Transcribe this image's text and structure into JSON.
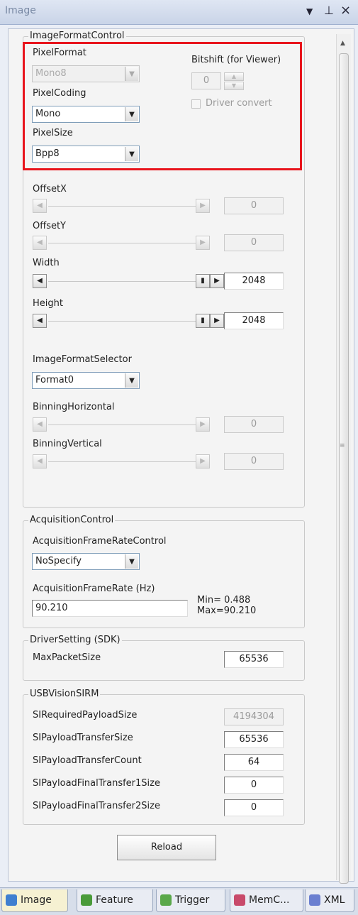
{
  "window": {
    "title": "Image",
    "dropdown_glyph": "▼",
    "pin_glyph": "⊥",
    "close_glyph": "×"
  },
  "image_format_control": {
    "legend": "ImageFormatControl",
    "pixel_format_label": "PixelFormat",
    "pixel_format_value": "Mono8",
    "bitshift_label": "Bitshift (for Viewer)",
    "bitshift_value": "0",
    "driver_convert_label": "Driver convert",
    "pixel_coding_label": "PixelCoding",
    "pixel_coding_value": "Mono",
    "pixel_size_label": "PixelSize",
    "pixel_size_value": "Bpp8",
    "offset_x_label": "OffsetX",
    "offset_x_value": "0",
    "offset_y_label": "OffsetY",
    "offset_y_value": "0",
    "width_label": "Width",
    "width_value": "2048",
    "height_label": "Height",
    "height_value": "2048",
    "selector_label": "ImageFormatSelector",
    "selector_value": "Format0",
    "binning_h_label": "BinningHorizontal",
    "binning_h_value": "0",
    "binning_v_label": "BinningVertical",
    "binning_v_value": "0"
  },
  "acquisition_control": {
    "legend": "AcquisitionControl",
    "rate_control_label": "AcquisitionFrameRateControl",
    "rate_control_value": "NoSpecify",
    "frame_rate_label": "AcquisitionFrameRate (Hz)",
    "frame_rate_value": "90.210",
    "min_text": "Min= 0.488",
    "max_text": "Max=90.210"
  },
  "driver_setting": {
    "legend": "DriverSetting (SDK)",
    "max_packet_label": "MaxPacketSize",
    "max_packet_value": "65536"
  },
  "usb_vision": {
    "legend": "USBVisionSIRM",
    "rows": [
      {
        "label": "SIRequiredPayloadSize",
        "value": "4194304"
      },
      {
        "label": "SIPayloadTransferSize",
        "value": "65536"
      },
      {
        "label": "SIPayloadTransferCount",
        "value": "64"
      },
      {
        "label": "SIPayloadFinalTransfer1Size",
        "value": "0"
      },
      {
        "label": "SIPayloadFinalTransfer2Size",
        "value": "0"
      }
    ]
  },
  "reload_label": "Reload",
  "tabs": [
    {
      "label": "Image",
      "color": "#3f7fd0"
    },
    {
      "label": "Feature",
      "color": "#4a9b3a"
    },
    {
      "label": "Trigger",
      "color": "#5aa84a"
    },
    {
      "label": "MemC...",
      "color": "#c84a6a"
    },
    {
      "label": "XML",
      "color": "#6a7fd0"
    }
  ]
}
